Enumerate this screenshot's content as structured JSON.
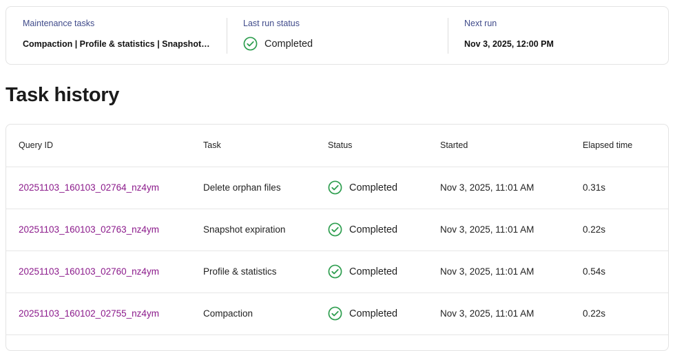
{
  "summary": {
    "tasks_label": "Maintenance tasks",
    "tasks_value": "Compaction | Profile & statistics | Snapshot expiration | Delete orphan files",
    "status_label": "Last run status",
    "status_value": "Completed",
    "next_label": "Next run",
    "next_value": "Nov 3, 2025, 12:00 PM"
  },
  "page_title": "Task history",
  "table": {
    "headers": {
      "query_id": "Query ID",
      "task": "Task",
      "status": "Status",
      "started": "Started",
      "elapsed": "Elapsed time"
    },
    "rows": [
      {
        "query_id": "20251103_160103_02764_nz4ym",
        "task": "Delete orphan files",
        "status": "Completed",
        "started": "Nov 3, 2025, 11:01 AM",
        "elapsed": "0.31s"
      },
      {
        "query_id": "20251103_160103_02763_nz4ym",
        "task": "Snapshot expiration",
        "status": "Completed",
        "started": "Nov 3, 2025, 11:01 AM",
        "elapsed": "0.22s"
      },
      {
        "query_id": "20251103_160103_02760_nz4ym",
        "task": "Profile & statistics",
        "status": "Completed",
        "started": "Nov 3, 2025, 11:01 AM",
        "elapsed": "0.54s"
      },
      {
        "query_id": "20251103_160102_02755_nz4ym",
        "task": "Compaction",
        "status": "Completed",
        "started": "Nov 3, 2025, 11:01 AM",
        "elapsed": "0.22s"
      }
    ]
  },
  "colors": {
    "link": "#8b1a8b",
    "success": "#2e9e4f",
    "label": "#3f4a8a"
  },
  "icons": {
    "status": "check-circle-icon"
  }
}
